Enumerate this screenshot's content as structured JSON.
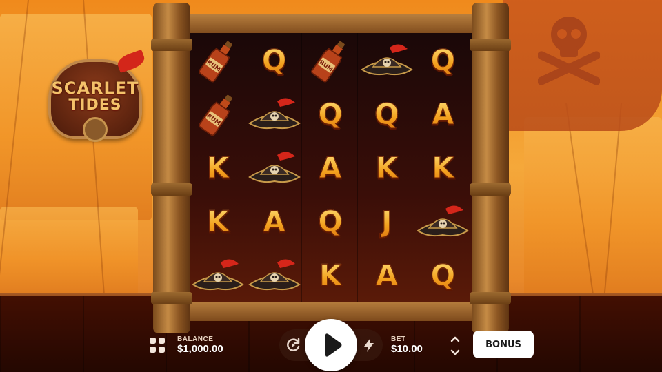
{
  "game": {
    "logo_line1": "SCARLET",
    "logo_line2": "TIDES"
  },
  "reels": [
    [
      "rum-bottle",
      "rum-bottle",
      "K",
      "K",
      "pirate-hat"
    ],
    [
      "Q",
      "pirate-hat",
      "pirate-hat",
      "A",
      "pirate-hat"
    ],
    [
      "rum-bottle",
      "Q",
      "A",
      "Q",
      "K"
    ],
    [
      "pirate-hat",
      "Q",
      "K",
      "J",
      "A"
    ],
    [
      "Q",
      "A",
      "K",
      "pirate-hat",
      "Q"
    ]
  ],
  "footer": {
    "balance_label": "BALANCE",
    "balance_value": "$1,000.00",
    "bet_label": "BET",
    "bet_value": "$10.00",
    "bonus_label": "BONUS"
  },
  "icons": {
    "menu": "grid-menu-icon",
    "autoplay": "autoplay-icon",
    "spin": "play-icon",
    "turbo": "lightning-icon",
    "bet_adjust": "chevron-up-down-icon"
  },
  "colors": {
    "background": "#f08a1c",
    "reel_bg": "#2a0a06",
    "symbol_gold": "#f3a21f",
    "button_bg": "#ffffff"
  }
}
